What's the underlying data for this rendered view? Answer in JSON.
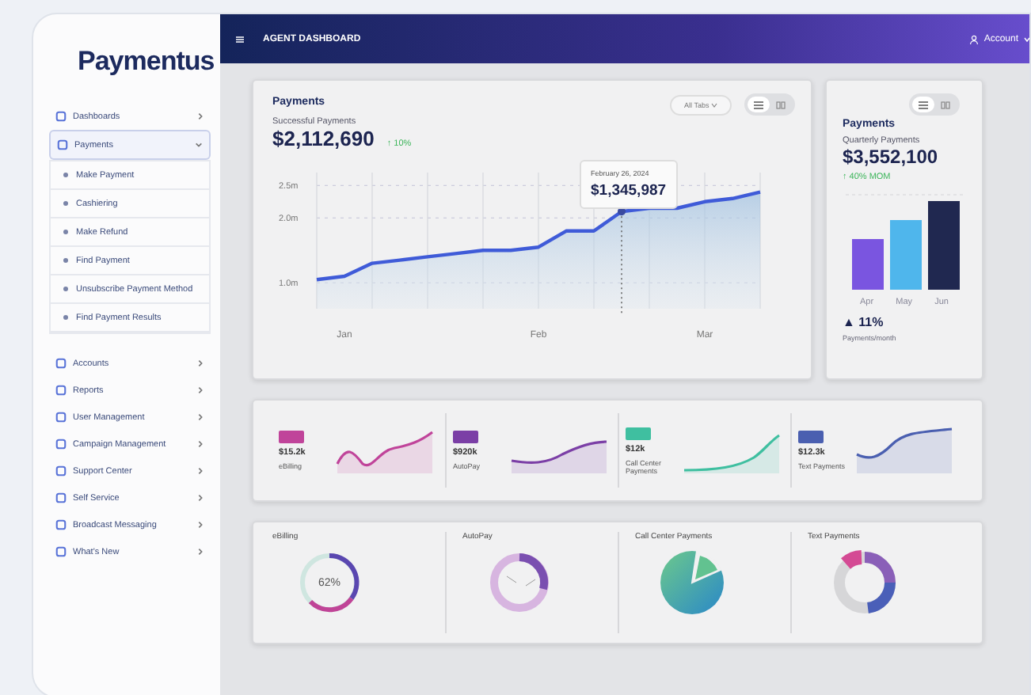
{
  "brand": "Paymentus",
  "sidebar": {
    "items": [
      {
        "label": "Dashboards",
        "expanded": false
      },
      {
        "label": "Payments",
        "expanded": true,
        "children": [
          {
            "label": "Make Payment"
          },
          {
            "label": "Cashiering"
          },
          {
            "label": "Make Refund"
          },
          {
            "label": "Find Payment"
          },
          {
            "label": "Unsubscribe Payment Method"
          },
          {
            "label": "Find Payment Results"
          }
        ]
      },
      {
        "label": "Accounts",
        "expanded": false
      },
      {
        "label": "Reports",
        "expanded": false
      },
      {
        "label": "User Management",
        "expanded": false
      },
      {
        "label": "Campaign Management",
        "expanded": false
      },
      {
        "label": "Support Center",
        "expanded": false
      },
      {
        "label": "Self Service",
        "expanded": false
      },
      {
        "label": "Broadcast Messaging",
        "expanded": false
      },
      {
        "label": "What's New",
        "expanded": false
      }
    ]
  },
  "header": {
    "title": "AGENT DASHBOARD",
    "user": "Account"
  },
  "payments_card": {
    "title": "Payments",
    "subtitle": "Successful Payments",
    "amount": "$2,112,690",
    "change": "↑ 10%",
    "filter": "All Tabs",
    "view_toggle": [
      {
        "kind": "list",
        "selected": true
      },
      {
        "kind": "grid",
        "selected": false
      }
    ],
    "tooltip": {
      "date": "February 26, 2024",
      "amount": "$1,345,987"
    },
    "chart_data": {
      "type": "area",
      "grid": true,
      "categories": [
        null,
        "Jan",
        null,
        null,
        null,
        null,
        null,
        null,
        "Feb",
        null,
        null,
        null,
        null,
        null,
        "Mar",
        null,
        null
      ],
      "ylim": [
        0.6,
        2.7
      ],
      "yticks": [
        {
          "value": 1.0,
          "label": "1.0m"
        },
        {
          "value": 2.0,
          "label": "2.0m"
        },
        {
          "value": 2.5,
          "label": "2.5m"
        }
      ],
      "series": [
        {
          "color": "#3f5bd8",
          "values": [
            1.05,
            1.1,
            1.3,
            1.35,
            1.4,
            1.45,
            1.5,
            1.5,
            1.55,
            1.8,
            1.8,
            2.1,
            2.15,
            2.15,
            2.25,
            2.3,
            2.4
          ]
        }
      ]
    }
  },
  "quarterly_card": {
    "title": "Payments",
    "subtitle": "Quarterly Payments",
    "amount": "$3,552,100",
    "change": "↑ 40% MOM",
    "view_toggle": [
      {
        "kind": "list",
        "selected": true
      },
      {
        "kind": "grid",
        "selected": false
      }
    ],
    "months": [
      "Apr",
      "May",
      "Jun"
    ],
    "growth": "▲ 11%",
    "growth_label": "Payments/month"
  },
  "kpis": [
    {
      "value": "$15.2k",
      "label": "eBilling",
      "color": "#c0449a"
    },
    {
      "value": "$920k",
      "label": "AutoPay",
      "color": "#7b3fa6"
    },
    {
      "value": "$12k",
      "label": "Call Center Payments",
      "color": "#3fbfa0"
    },
    {
      "value": "$12.3k",
      "label": "Text Payments",
      "color": "#4a5fb0"
    }
  ],
  "breakdowns": [
    {
      "title": "eBilling",
      "kind": "ring",
      "center": "62%"
    },
    {
      "title": "AutoPay",
      "kind": "split"
    },
    {
      "title": "Call Center Payments",
      "kind": "pie"
    },
    {
      "title": "Text Payments",
      "kind": "segments"
    }
  ]
}
